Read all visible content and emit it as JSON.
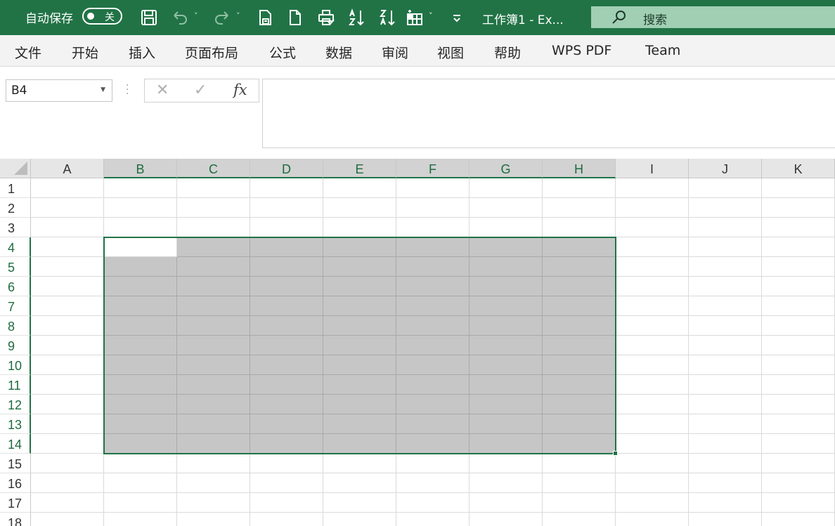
{
  "titlebar": {
    "autosave_label": "自动保存",
    "autosave_state": "关",
    "doc_title": "工作簿1  -  Ex...",
    "search_placeholder": "搜索",
    "quick_access_icons": [
      "save-icon",
      "undo-icon",
      "redo-icon",
      "print-preview-icon",
      "new-document-icon",
      "quick-print-icon",
      "sort-ascending-icon",
      "sort-descending-icon",
      "format-icon",
      "customize-toolbar-icon"
    ]
  },
  "tabs": [
    "文件",
    "开始",
    "插入",
    "页面布局",
    "公式",
    "数据",
    "审阅",
    "视图",
    "帮助",
    "WPS PDF",
    "Team"
  ],
  "formula_bar": {
    "name_box": "B4",
    "cancel_glyph": "✕",
    "enter_glyph": "✓",
    "fx_label": "fx",
    "content": ""
  },
  "grid": {
    "columns": [
      "A",
      "B",
      "C",
      "D",
      "E",
      "F",
      "G",
      "H",
      "I",
      "J",
      "K"
    ],
    "rows": [
      "1",
      "2",
      "3",
      "4",
      "5",
      "6",
      "7",
      "8",
      "9",
      "10",
      "11",
      "12",
      "13",
      "14",
      "15",
      "16",
      "17",
      "18"
    ],
    "selected_range": "B4:H14",
    "active_cell": "B4"
  },
  "colors": {
    "brand": "#217346",
    "selection_fill": "#c6c6c6",
    "search_bg": "#a0cfb4"
  }
}
